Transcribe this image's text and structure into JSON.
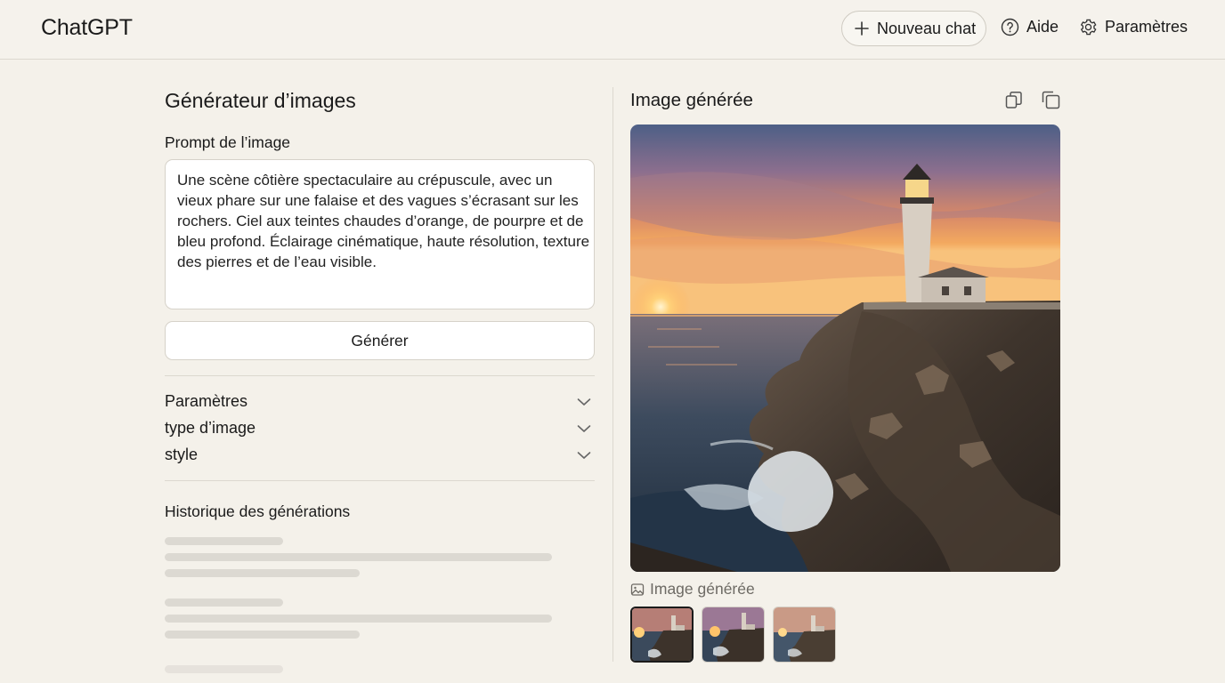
{
  "app": {
    "title": "ChatGPT"
  },
  "header": {
    "new_chat_label": "Nouveau chat",
    "help_label": "Aide",
    "settings_label": "Paramètres"
  },
  "generator": {
    "title": "Générateur d’images",
    "prompt_label": "Prompt de l’image",
    "prompt_value": "Une scène côtière spectaculaire au crépuscule, avec un vieux phare sur une falaise et des vagues s’écrasant sur les rochers. Ciel aux teintes chaudes d’orange, de pourpre et de bleu profond. Éclairage cinématique, haute résolution, texture des pierres et de l’eau visible.",
    "generate_label": "Générer",
    "options": [
      {
        "label": "Paramètres"
      },
      {
        "label": "type d’image"
      },
      {
        "label": "style"
      }
    ],
    "history_title": "Historique des générations"
  },
  "result": {
    "title": "Image générée",
    "caption": "Image générée",
    "thumbnails": [
      {
        "selected": true
      },
      {
        "selected": false
      },
      {
        "selected": false
      }
    ]
  },
  "colors": {
    "background": "#f4f1ea",
    "card": "#ffffff",
    "border": "#d6d2c9",
    "skeleton": "#dcd9d2"
  }
}
